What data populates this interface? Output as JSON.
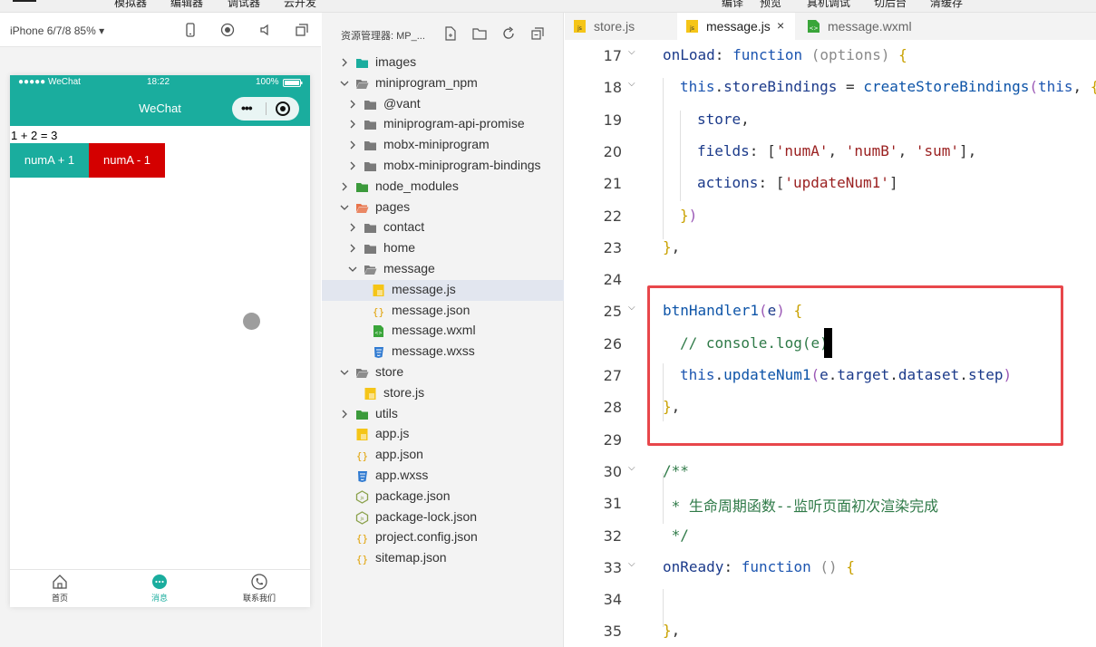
{
  "menu": {
    "items": [
      "模拟器",
      "编辑器",
      "调试器",
      "云开发"
    ],
    "right_items": [
      "编译",
      "预览",
      "真机调试",
      "切后台",
      "清缓存"
    ]
  },
  "simulator": {
    "device": "iPhone 6/7/8 85% ▾",
    "status": {
      "carrier": "●●●●● WeChat",
      "time": "18:22",
      "battery": "100%"
    },
    "nav_title": "WeChat",
    "equation": "1 + 2 = 3",
    "buttons": [
      "numA + 1",
      "numA - 1"
    ],
    "tabbar": [
      {
        "label": "首页",
        "icon": "home-icon"
      },
      {
        "label": "消息",
        "icon": "message-icon"
      },
      {
        "label": "联系我们",
        "icon": "phone-icon"
      }
    ],
    "colors": {
      "primary": "#1aad9e",
      "danger": "#d40000"
    }
  },
  "explorer": {
    "title": "资源管理器: MP_...",
    "items": [
      {
        "label": "images",
        "type": "folder",
        "depth": 0,
        "expanded": false,
        "color": "#1aad9e"
      },
      {
        "label": "miniprogram_npm",
        "type": "folder",
        "depth": 0,
        "expanded": true,
        "color": "#7a7a7a"
      },
      {
        "label": "@vant",
        "type": "folder",
        "depth": 1,
        "expanded": false,
        "color": "#7a7a7a"
      },
      {
        "label": "miniprogram-api-promise",
        "type": "folder",
        "depth": 1,
        "expanded": false,
        "color": "#7a7a7a"
      },
      {
        "label": "mobx-miniprogram",
        "type": "folder",
        "depth": 1,
        "expanded": false,
        "color": "#7a7a7a"
      },
      {
        "label": "mobx-miniprogram-bindings",
        "type": "folder",
        "depth": 1,
        "expanded": false,
        "color": "#7a7a7a"
      },
      {
        "label": "node_modules",
        "type": "folder",
        "depth": 0,
        "expanded": false,
        "color": "#3c9a3c"
      },
      {
        "label": "pages",
        "type": "folder",
        "depth": 0,
        "expanded": true,
        "color": "#e8734a"
      },
      {
        "label": "contact",
        "type": "folder",
        "depth": 1,
        "expanded": false,
        "color": "#7a7a7a"
      },
      {
        "label": "home",
        "type": "folder",
        "depth": 1,
        "expanded": false,
        "color": "#7a7a7a"
      },
      {
        "label": "message",
        "type": "folder",
        "depth": 1,
        "expanded": true,
        "color": "#7a7a7a"
      },
      {
        "label": "message.js",
        "type": "js",
        "depth": 2,
        "selected": true
      },
      {
        "label": "message.json",
        "type": "json",
        "depth": 2
      },
      {
        "label": "message.wxml",
        "type": "wxml",
        "depth": 2
      },
      {
        "label": "message.wxss",
        "type": "wxss",
        "depth": 2
      },
      {
        "label": "store",
        "type": "folder",
        "depth": 0,
        "expanded": true,
        "color": "#7a7a7a"
      },
      {
        "label": "store.js",
        "type": "js",
        "depth": 1
      },
      {
        "label": "utils",
        "type": "folder",
        "depth": 0,
        "expanded": false,
        "color": "#3c9a3c"
      },
      {
        "label": "app.js",
        "type": "js",
        "depth": 0
      },
      {
        "label": "app.json",
        "type": "json",
        "depth": 0
      },
      {
        "label": "app.wxss",
        "type": "wxss",
        "depth": 0
      },
      {
        "label": "package.json",
        "type": "npm",
        "depth": 0
      },
      {
        "label": "package-lock.json",
        "type": "npm",
        "depth": 0
      },
      {
        "label": "project.config.json",
        "type": "json",
        "depth": 0
      },
      {
        "label": "sitemap.json",
        "type": "json",
        "depth": 0
      }
    ]
  },
  "editor": {
    "tabs": [
      {
        "label": "store.js",
        "type": "js",
        "active": false
      },
      {
        "label": "message.js",
        "type": "js",
        "active": true,
        "close": "×"
      },
      {
        "label": "message.wxml",
        "type": "wxml",
        "active": false
      }
    ],
    "lines": [
      {
        "num": "17",
        "fold": true,
        "indent": 0,
        "parts": [
          [
            "prop",
            "onLoad"
          ],
          [
            "punc",
            ": "
          ],
          [
            "kw",
            "function"
          ],
          [
            "punc",
            " "
          ],
          [
            "param",
            "(options)"
          ],
          [
            "punc",
            " "
          ],
          [
            "brace-y",
            "{"
          ]
        ]
      },
      {
        "num": "18",
        "fold": true,
        "indent": 1,
        "parts": [
          [
            "kw",
            "this"
          ],
          [
            "punc",
            "."
          ],
          [
            "prop",
            "storeBindings"
          ],
          [
            "punc",
            " = "
          ],
          [
            "fn",
            "createStoreBindings"
          ],
          [
            "brace-p",
            "("
          ],
          [
            "kw",
            "this"
          ],
          [
            "punc",
            ", "
          ],
          [
            "brace-y",
            "{"
          ]
        ]
      },
      {
        "num": "19",
        "fold": false,
        "indent": 2,
        "parts": [
          [
            "prop",
            "store"
          ],
          [
            "punc",
            ","
          ]
        ]
      },
      {
        "num": "20",
        "fold": false,
        "indent": 2,
        "parts": [
          [
            "prop",
            "fields"
          ],
          [
            "punc",
            ": "
          ],
          [
            "punc",
            "["
          ],
          [
            "str",
            "'numA'"
          ],
          [
            "punc",
            ", "
          ],
          [
            "str",
            "'numB'"
          ],
          [
            "punc",
            ", "
          ],
          [
            "str",
            "'sum'"
          ],
          [
            "punc",
            "],"
          ]
        ]
      },
      {
        "num": "21",
        "fold": false,
        "indent": 2,
        "parts": [
          [
            "prop",
            "actions"
          ],
          [
            "punc",
            ": "
          ],
          [
            "punc",
            "["
          ],
          [
            "str",
            "'updateNum1'"
          ],
          [
            "punc",
            "]"
          ]
        ]
      },
      {
        "num": "22",
        "fold": false,
        "indent": 1,
        "parts": [
          [
            "brace-y",
            "}"
          ],
          [
            "brace-p",
            ")"
          ]
        ]
      },
      {
        "num": "23",
        "fold": false,
        "indent": 0,
        "parts": [
          [
            "brace-y",
            "}"
          ],
          [
            "punc",
            ","
          ]
        ]
      },
      {
        "num": "24",
        "fold": false,
        "indent": 0,
        "parts": []
      },
      {
        "num": "25",
        "fold": true,
        "indent": 0,
        "parts": [
          [
            "fn",
            "btnHandler1"
          ],
          [
            "brace-p",
            "("
          ],
          [
            "prop",
            "e"
          ],
          [
            "brace-p",
            ")"
          ],
          [
            "punc",
            " "
          ],
          [
            "brace-y",
            "{"
          ]
        ]
      },
      {
        "num": "26",
        "fold": false,
        "indent": 1,
        "parts": [
          [
            "comment",
            "// console.log(e)"
          ]
        ]
      },
      {
        "num": "27",
        "fold": false,
        "indent": 1,
        "parts": [
          [
            "kw",
            "this"
          ],
          [
            "punc",
            "."
          ],
          [
            "fn",
            "updateNum1"
          ],
          [
            "brace-p",
            "("
          ],
          [
            "prop",
            "e"
          ],
          [
            "punc",
            "."
          ],
          [
            "prop",
            "target"
          ],
          [
            "punc",
            "."
          ],
          [
            "prop",
            "dataset"
          ],
          [
            "punc",
            "."
          ],
          [
            "prop",
            "step"
          ],
          [
            "brace-p",
            ")"
          ]
        ]
      },
      {
        "num": "28",
        "fold": false,
        "indent": 0,
        "parts": [
          [
            "brace-y",
            "}"
          ],
          [
            "punc",
            ","
          ]
        ]
      },
      {
        "num": "29",
        "fold": false,
        "indent": 0,
        "parts": []
      },
      {
        "num": "30",
        "fold": true,
        "indent": 0,
        "parts": [
          [
            "comment",
            "/**"
          ]
        ]
      },
      {
        "num": "31",
        "fold": false,
        "indent": 0,
        "parts": [
          [
            "comment",
            " * 生命周期函数--监听页面初次渲染完成"
          ]
        ]
      },
      {
        "num": "32",
        "fold": false,
        "indent": 0,
        "parts": [
          [
            "comment",
            " */"
          ]
        ]
      },
      {
        "num": "33",
        "fold": true,
        "indent": 0,
        "parts": [
          [
            "prop",
            "onReady"
          ],
          [
            "punc",
            ": "
          ],
          [
            "kw",
            "function"
          ],
          [
            "punc",
            " "
          ],
          [
            "param",
            "()"
          ],
          [
            "punc",
            " "
          ],
          [
            "brace-y",
            "{"
          ]
        ]
      },
      {
        "num": "34",
        "fold": false,
        "indent": 0,
        "parts": []
      },
      {
        "num": "35",
        "fold": false,
        "indent": 0,
        "parts": [
          [
            "brace-y",
            "}"
          ],
          [
            "punc",
            ","
          ]
        ]
      }
    ],
    "highlight_color": "#e8474b"
  }
}
